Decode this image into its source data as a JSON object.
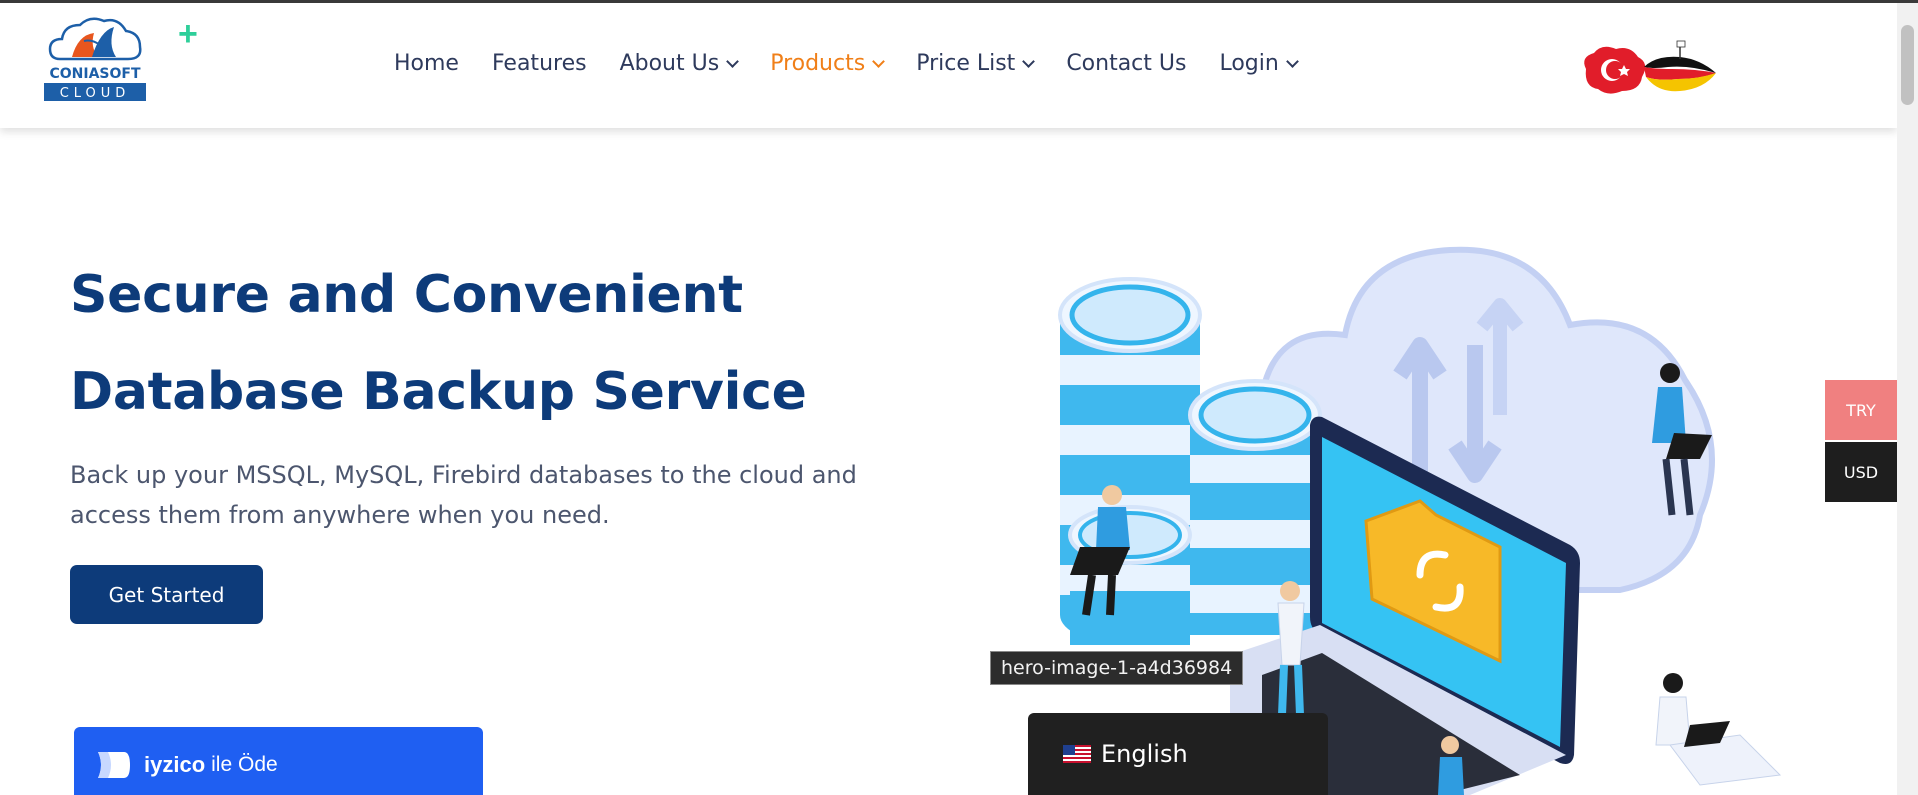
{
  "brand": {
    "name_top": "CONIASOFT",
    "name_bottom": "CLOUD"
  },
  "nav": [
    {
      "label": "Home",
      "dropdown": false,
      "active": false
    },
    {
      "label": "Features",
      "dropdown": false,
      "active": false
    },
    {
      "label": "About Us",
      "dropdown": true,
      "active": false
    },
    {
      "label": "Products",
      "dropdown": true,
      "active": true
    },
    {
      "label": "Price List",
      "dropdown": true,
      "active": false
    },
    {
      "label": "Contact Us",
      "dropdown": false,
      "active": false
    },
    {
      "label": "Login",
      "dropdown": true,
      "active": false
    }
  ],
  "hero": {
    "title_line1": "Secure and Convenient",
    "title_line2": "Database Backup Service",
    "description": "Back up your MSSQL, MySQL, Firebird databases to the cloud and access them from anywhere when you need.",
    "cta_label": "Get Started"
  },
  "payment": {
    "brand": "iyzico",
    "text": "ile Öde"
  },
  "tooltip": "hero-image-1-a4d36984",
  "language": {
    "label": "English",
    "flag_icon": "us-flag-icon"
  },
  "currency": {
    "try_label": "TRY",
    "usd_label": "USD"
  },
  "colors": {
    "primary": "#0d3b7a",
    "accent": "#f07f18",
    "payment": "#1f5ff2"
  }
}
